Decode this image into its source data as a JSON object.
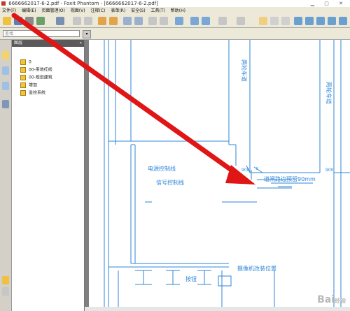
{
  "window": {
    "title": "6666662017-6-2.pdf - Foxit Phantom - [6666662017-6-2.pdf]"
  },
  "menu": [
    "文件(F)",
    "编辑(E)",
    "页面管理(O)",
    "视图(V)",
    "注释(C)",
    "表单(R)",
    "安全(S)",
    "工具(T)",
    "帮助(H)"
  ],
  "toolbar2": {
    "search_placeholder": "查找"
  },
  "panel": {
    "title": "图层",
    "layers": [
      "0",
      "00-用地红线",
      "00-规划建筑",
      "增加",
      "监控系统"
    ]
  },
  "drawing": {
    "labels": {
      "lane_left": "两轮车道",
      "lane_right": "两轮车道",
      "power_line": "电源控制线",
      "signal_line": "信号控制线",
      "gate_note": "道闸路边预留90mm",
      "camera": "摄像机改装位置",
      "button": "按钮",
      "dim1": "900",
      "dim2": "900"
    }
  },
  "watermark": {
    "brand": "Bai",
    "suffix": "经验"
  },
  "colors": {
    "cad_line": "#2f86d8",
    "arrow": "#e01515"
  }
}
